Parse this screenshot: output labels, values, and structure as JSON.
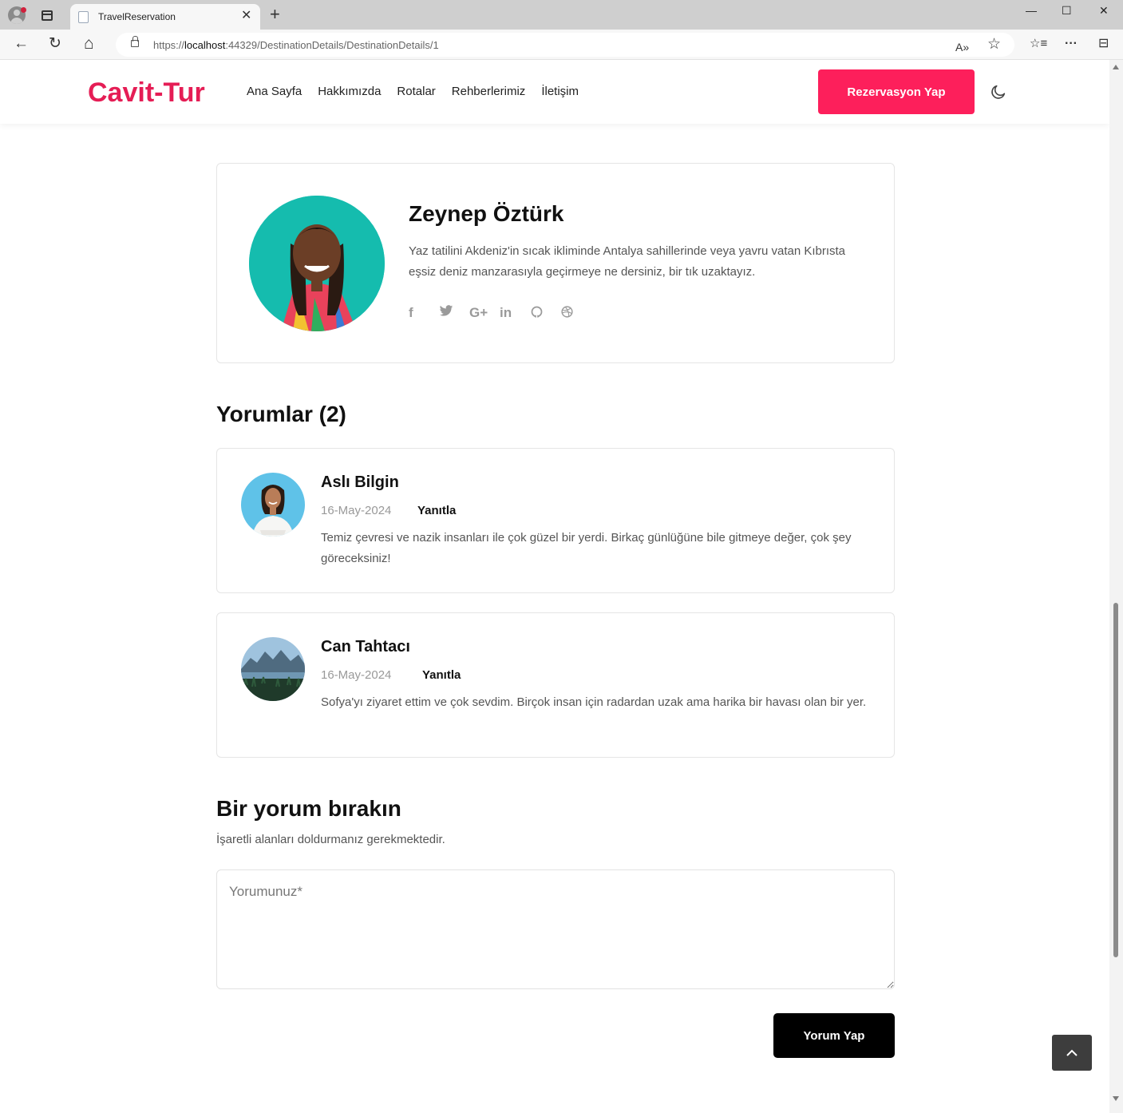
{
  "browser": {
    "tab_title": "TravelReservation",
    "tab_close": "✕",
    "new_tab": "+",
    "url_prefix": "https://",
    "url_host": "localhost",
    "url_rest": ":44329/DestinationDetails/DestinationDetails/1",
    "minimize": "—",
    "maximize": "☐",
    "close": "✕",
    "back": "←",
    "reload": "↻",
    "home": "⌂",
    "read_aloud": "A»",
    "favorite": "☆",
    "favorites": "☆≡",
    "more": "···",
    "sidebar": "⊟"
  },
  "header": {
    "logo": "Cavit-Tur",
    "menu": [
      "Ana Sayfa",
      "Hakkımızda",
      "Rotalar",
      "Rehberlerimiz",
      "İletişim"
    ],
    "cta_label": "Rezervasyon Yap"
  },
  "author": {
    "name": "Zeynep Öztürk",
    "bio": "Yaz tatilini Akdeniz'in sıcak ikliminde Antalya sahillerinde veya yavru vatan Kıbrısta eşsiz deniz manzarasıyla geçirmeye ne dersiniz, bir tık uzaktayız.",
    "socials": [
      {
        "icon": "facebook-icon",
        "glyph": "f"
      },
      {
        "icon": "twitter-icon",
        "glyph": "🐦"
      },
      {
        "icon": "google-plus-icon",
        "glyph": "G+"
      },
      {
        "icon": "linkedin-icon",
        "glyph": "in"
      },
      {
        "icon": "github-icon",
        "glyph": "◯"
      },
      {
        "icon": "dribbble-icon",
        "glyph": "⊛"
      }
    ]
  },
  "comments": {
    "title": "Yorumlar (2)",
    "items": [
      {
        "name": "Aslı Bilgin",
        "date": "16-May-2024",
        "reply": "Yanıtla",
        "text": "Temiz çevresi ve nazik insanları ile çok güzel bir yerdi. Birkaç günlüğüne bile gitmeye değer, çok şey göreceksiniz!"
      },
      {
        "name": "Can Tahtacı",
        "date": "16-May-2024",
        "reply": "Yanıtla",
        "text": "Sofya'yı ziyaret ettim ve çok sevdim. Birçok insan için radardan uzak ama harika bir havası olan bir yer."
      }
    ]
  },
  "form": {
    "title": "Bir yorum bırakın",
    "subtitle": "İşaretli alanları doldurmanız gerekmektedir.",
    "placeholder": "Yorumunuz*",
    "submit_label": "Yorum Yap"
  },
  "colors": {
    "brand": "#e51d55",
    "cta": "#fd1f5b",
    "dark_button": "#000000"
  }
}
